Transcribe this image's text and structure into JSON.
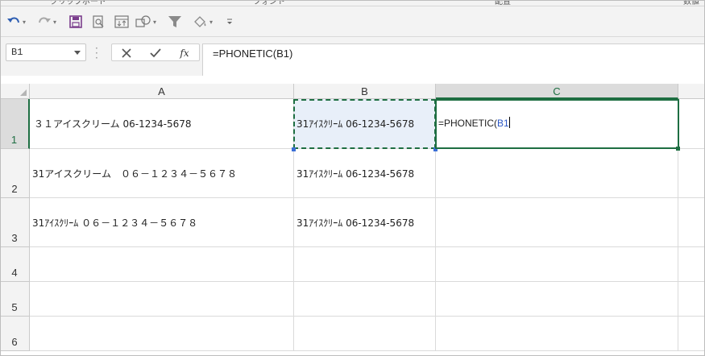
{
  "ribbon": {
    "groups": [
      "クリップボード",
      "フォント",
      "配置",
      "数値"
    ]
  },
  "toolbar": {
    "undo_icon": "undo-icon",
    "redo_icon": "redo-icon",
    "save_icon": "save-icon",
    "print_preview_icon": "print-preview-icon",
    "sort_icon": "sort-icon",
    "shapes_icon": "shapes-icon",
    "filter_icon": "filter-icon",
    "fill_icon": "fill-color-icon",
    "customize_icon": "customize-icon"
  },
  "formula_bar": {
    "name_box": "B1",
    "cancel_icon": "cancel-icon",
    "enter_icon": "enter-icon",
    "fx_label": "fx",
    "formula": "=PHONETIC(B1)"
  },
  "sheet": {
    "columns": [
      "A",
      "B",
      "C"
    ],
    "selected_column": "C",
    "selected_row": "1",
    "rows": [
      {
        "number": "1",
        "a": "３１アイスクリーム 06-1234-5678",
        "b": "31ｱｲｽｸﾘｰﾑ 06-1234-5678"
      },
      {
        "number": "2",
        "a": "31アイスクリーム　０６－１２３４－５６７８",
        "b": "31ｱｲｽｸﾘｰﾑ 06-1234-5678"
      },
      {
        "number": "3",
        "a": "31ｱｲｽｸﾘｰﾑ ０６－１２３４－５６７８",
        "b": "31ｱｲｽｸﾘｰﾑ 06-1234-5678"
      },
      {
        "number": "4",
        "a": "",
        "b": ""
      },
      {
        "number": "5",
        "a": "",
        "b": ""
      },
      {
        "number": "6",
        "a": "",
        "b": ""
      }
    ],
    "editing_cell": {
      "prefix": "=PHONETIC(",
      "ref": "B1",
      "suffix": ""
    }
  },
  "colors": {
    "accent": "#1e6e42",
    "reference": "#2b57c5",
    "copy_fill": "#e8eff9"
  }
}
